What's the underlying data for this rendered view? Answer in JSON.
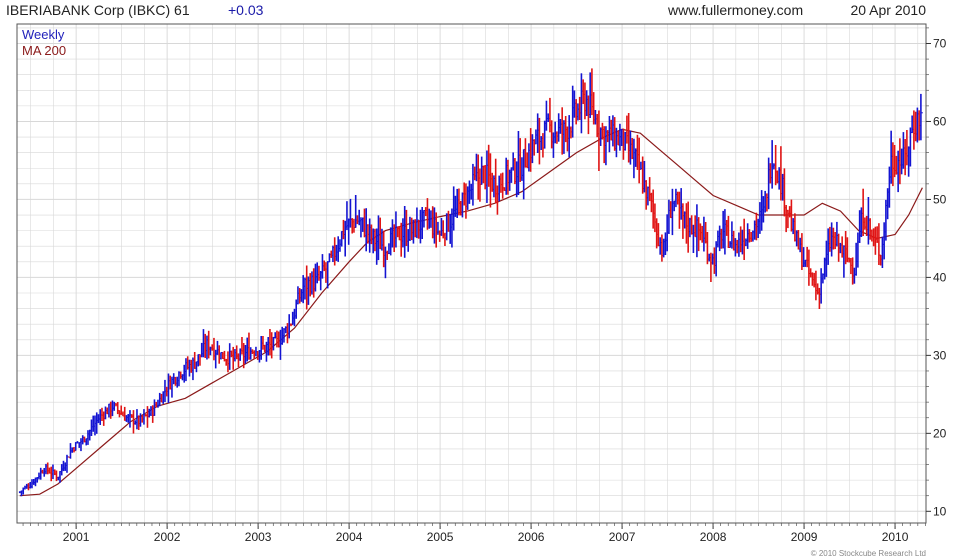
{
  "header": {
    "title": "IBERIABANK Corp (IBKC) 61",
    "change": "+0.03",
    "site": "www.fullermoney.com",
    "date": "20 Apr 2010"
  },
  "legend": {
    "period": "Weekly",
    "ma": "MA 200"
  },
  "copyright": "© 2010 Stockcube Research Ltd",
  "colors": {
    "up": "#1414d2",
    "down": "#e01414",
    "ma": "#8b1a1a",
    "grid": "#d8d8d8",
    "frame": "#555555",
    "period_text": "#2222bb",
    "ma_text": "#8b1a1a"
  },
  "chart_data": {
    "type": "line",
    "xlim": [
      2000.35,
      2010.34
    ],
    "ylim": [
      8.5,
      72.5
    ],
    "x_ticks": [
      2001,
      2002,
      2003,
      2004,
      2005,
      2006,
      2007,
      2008,
      2009,
      2010
    ],
    "y_ticks": [
      10,
      20,
      30,
      40,
      50,
      60,
      70
    ],
    "grid": true,
    "legend_position": "top-left",
    "series": [
      {
        "name": "Weekly",
        "style": "hlc_bars",
        "x": [
          2000.38,
          2000.5,
          2000.65,
          2000.8,
          2000.95,
          2001.1,
          2001.25,
          2001.4,
          2001.55,
          2001.7,
          2001.85,
          2002.0,
          2002.15,
          2002.3,
          2002.45,
          2002.6,
          2002.75,
          2002.9,
          2003.05,
          2003.2,
          2003.35,
          2003.5,
          2003.65,
          2003.8,
          2003.95,
          2004.1,
          2004.25,
          2004.4,
          2004.55,
          2004.7,
          2004.85,
          2005.0,
          2005.15,
          2005.3,
          2005.45,
          2005.6,
          2005.75,
          2005.9,
          2006.05,
          2006.2,
          2006.35,
          2006.5,
          2006.6,
          2006.75,
          2006.85,
          2007.0,
          2007.15,
          2007.3,
          2007.45,
          2007.55,
          2007.7,
          2007.85,
          2008.0,
          2008.1,
          2008.25,
          2008.4,
          2008.55,
          2008.65,
          2008.75,
          2008.9,
          2009.05,
          2009.15,
          2009.3,
          2009.45,
          2009.55,
          2009.65,
          2009.75,
          2009.85,
          2009.95,
          2010.1,
          2010.2,
          2010.3
        ],
        "values": [
          12.5,
          13.5,
          15.5,
          14.5,
          18.0,
          19.5,
          22.0,
          23.5,
          22.0,
          21.5,
          23.0,
          26.0,
          28.0,
          29.0,
          31.5,
          30.0,
          29.5,
          30.5,
          31.0,
          31.5,
          34.0,
          39.0,
          39.5,
          42.0,
          46.5,
          47.5,
          45.0,
          44.0,
          45.5,
          46.0,
          47.5,
          45.5,
          48.0,
          50.5,
          53.5,
          52.0,
          53.0,
          54.5,
          57.5,
          59.0,
          58.5,
          61.0,
          63.0,
          59.0,
          58.0,
          57.5,
          55.0,
          50.0,
          43.0,
          50.0,
          47.0,
          46.0,
          42.0,
          46.0,
          44.0,
          46.0,
          48.0,
          56.0,
          52.0,
          45.0,
          40.5,
          38.0,
          45.0,
          43.0,
          41.0,
          48.5,
          45.0,
          43.0,
          55.0,
          55.0,
          59.5,
          61.0
        ]
      },
      {
        "name": "MA 200",
        "x": [
          2000.38,
          2000.6,
          2000.8,
          2001.0,
          2001.3,
          2001.6,
          2001.9,
          2002.2,
          2002.5,
          2002.8,
          2003.1,
          2003.4,
          2003.7,
          2004.0,
          2004.2,
          2004.4,
          2004.7,
          2005.0,
          2005.3,
          2005.6,
          2005.9,
          2006.2,
          2006.5,
          2006.8,
          2007.0,
          2007.2,
          2007.4,
          2007.6,
          2007.8,
          2008.0,
          2008.3,
          2008.5,
          2008.8,
          2009.0,
          2009.2,
          2009.4,
          2009.6,
          2009.8,
          2010.0,
          2010.15,
          2010.3
        ],
        "values": [
          12.0,
          12.2,
          13.5,
          15.5,
          18.5,
          21.5,
          23.5,
          24.5,
          26.5,
          28.5,
          30.5,
          33.5,
          38.0,
          42.0,
          44.5,
          46.0,
          47.0,
          47.8,
          48.5,
          49.5,
          51.0,
          53.5,
          56.0,
          58.0,
          59.0,
          58.5,
          56.5,
          54.5,
          52.5,
          50.5,
          49.0,
          48.0,
          48.0,
          48.0,
          49.5,
          48.5,
          46.0,
          45.0,
          45.5,
          48.0,
          51.5
        ]
      }
    ]
  }
}
